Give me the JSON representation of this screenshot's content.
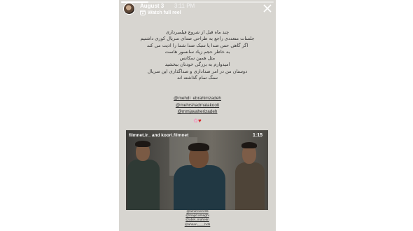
{
  "header": {
    "username": "August 3",
    "timestamp": "3:11 PM",
    "watch_full_reel": "Watch full reel",
    "progress": 0.18
  },
  "caption_lines": [
    "چند ماه قبل از شروع فیلمبرداری",
    "جلسات متعددی راجع به طراحی صدای سریال کوری داشتیم",
    "اگر گاهی حس صدا یا سبک صدا شما را اذیت می کند",
    "به خاطر حجم زیاد سانسور هاست",
    "مثل همین سکانس",
    "امیدوارم به بزرگی خودتان ببخشید",
    "دوستان من در امر صداداری و صداگذاری این سریال",
    "سنگ تمام گذاشته اند"
  ],
  "mentions": [
    "@mehdi_ebrahimzadeh",
    "@mehrshadmalakooti",
    "@mmjavaherizadeh"
  ],
  "video": {
    "title": "filmnet.ir_ and koori.filmnet",
    "duration": "1:15"
  },
  "credits": [
    "@amirroozi.55",
    "@majid.amaghi",
    "@abel_mahekn",
    "@ahsan____bd5"
  ]
}
